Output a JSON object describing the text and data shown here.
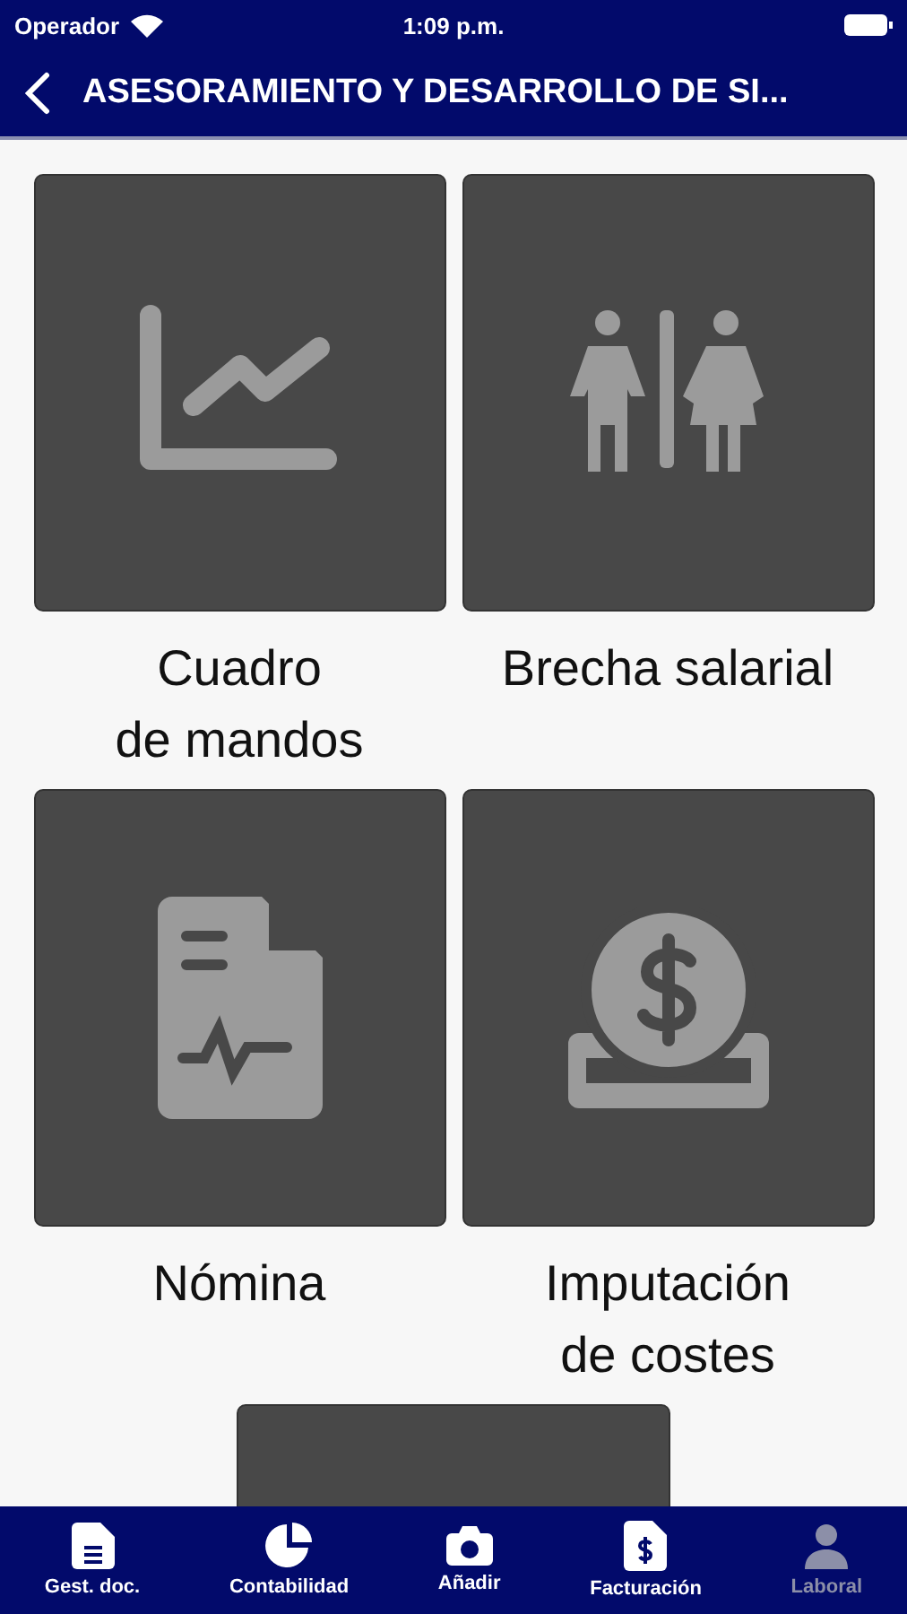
{
  "status_bar": {
    "carrier": "Operador",
    "time": "1:09 p.m."
  },
  "nav_bar": {
    "title": "ASESORAMIENTO Y DESARROLLO DE SI..."
  },
  "tiles": [
    {
      "kind": "tile",
      "label": "Cuadro\nde mandos"
    },
    {
      "kind": "tile",
      "label": "Brecha salarial"
    },
    {
      "kind": "tile",
      "label": "Nómina"
    },
    {
      "kind": "tile",
      "label": "Imputación\nde costes"
    },
    {
      "kind": "partial"
    }
  ],
  "tab_bar": [
    {
      "label": "Gest. doc.",
      "selected": false
    },
    {
      "label": "Contabilidad",
      "selected": false
    },
    {
      "label": "Añadir",
      "selected": false
    },
    {
      "label": "Facturación",
      "selected": false
    },
    {
      "label": "Laboral",
      "selected": true
    }
  ]
}
